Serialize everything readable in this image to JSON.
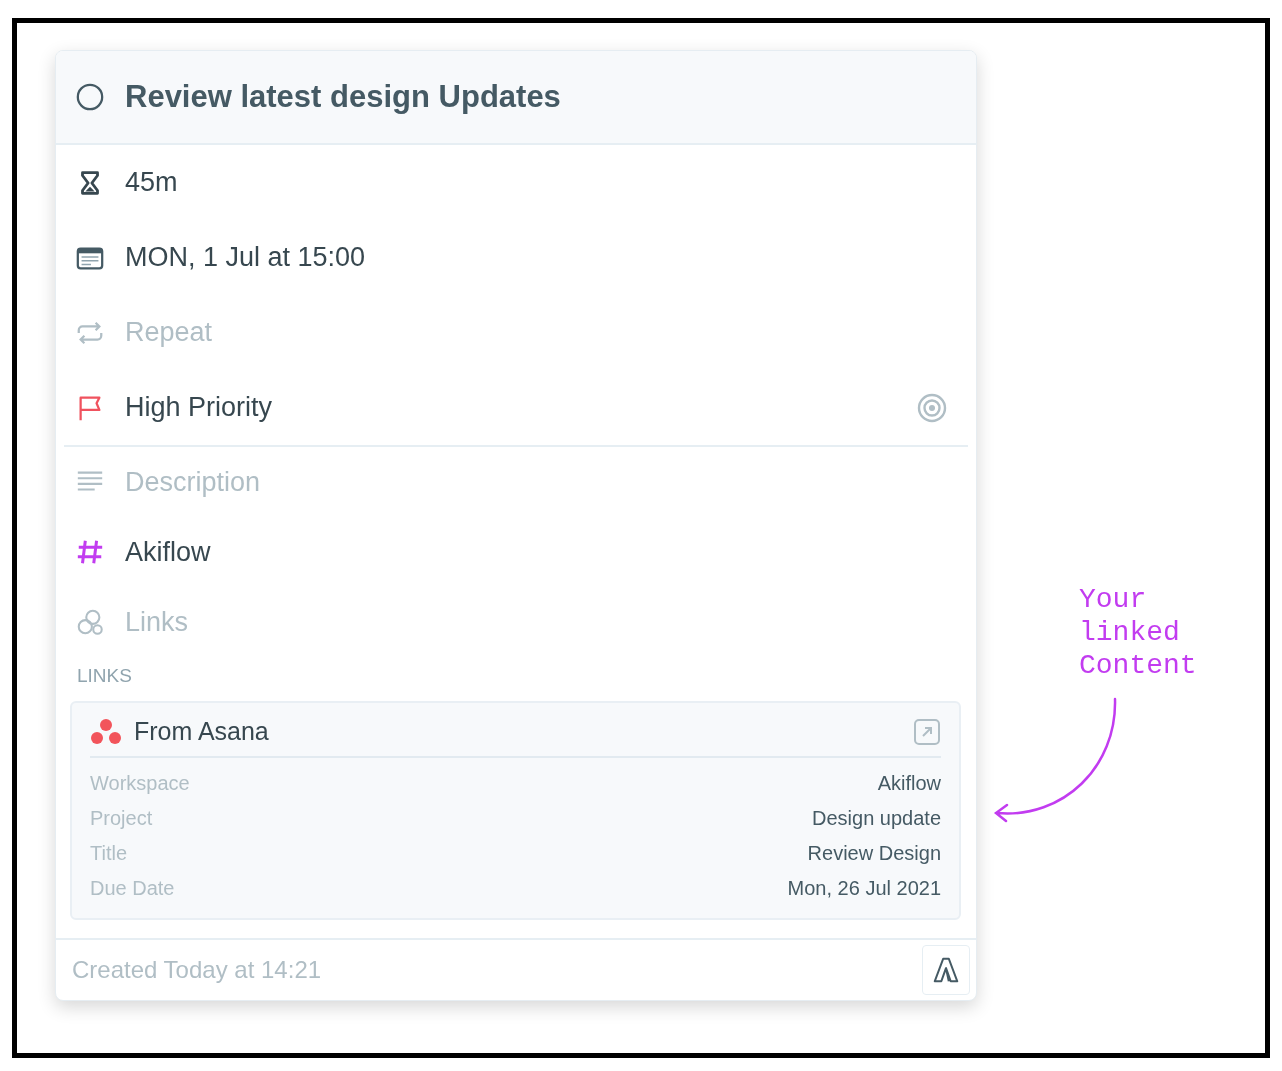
{
  "task": {
    "title": "Review latest design Updates",
    "completed": false
  },
  "fields": [
    {
      "kind": "duration",
      "text": "45m",
      "empty": false
    },
    {
      "kind": "date",
      "text": "MON, 1 Jul at 15:00",
      "empty": false
    },
    {
      "kind": "repeat",
      "text": "Repeat",
      "empty": true
    },
    {
      "kind": "priority",
      "text": "High Priority",
      "empty": false
    }
  ],
  "details": [
    {
      "kind": "description",
      "text": "Description",
      "empty": true
    },
    {
      "kind": "project",
      "text": "Akiflow",
      "empty": false
    },
    {
      "kind": "links",
      "text": "Links",
      "empty": true
    }
  ],
  "links_heading": "LINKS",
  "link_card": {
    "source": "From Asana",
    "rows": [
      {
        "label": "Workspace",
        "value": "Akiflow"
      },
      {
        "label": "Project",
        "value": "Design update"
      },
      {
        "label": "Title",
        "value": "Review Design"
      },
      {
        "label": "Due Date",
        "value": "Mon, 26 Jul 2021"
      }
    ]
  },
  "footer": {
    "created": "Created Today at 14:21"
  },
  "annotation": {
    "lines": [
      "Your",
      "linked",
      "Content"
    ]
  }
}
